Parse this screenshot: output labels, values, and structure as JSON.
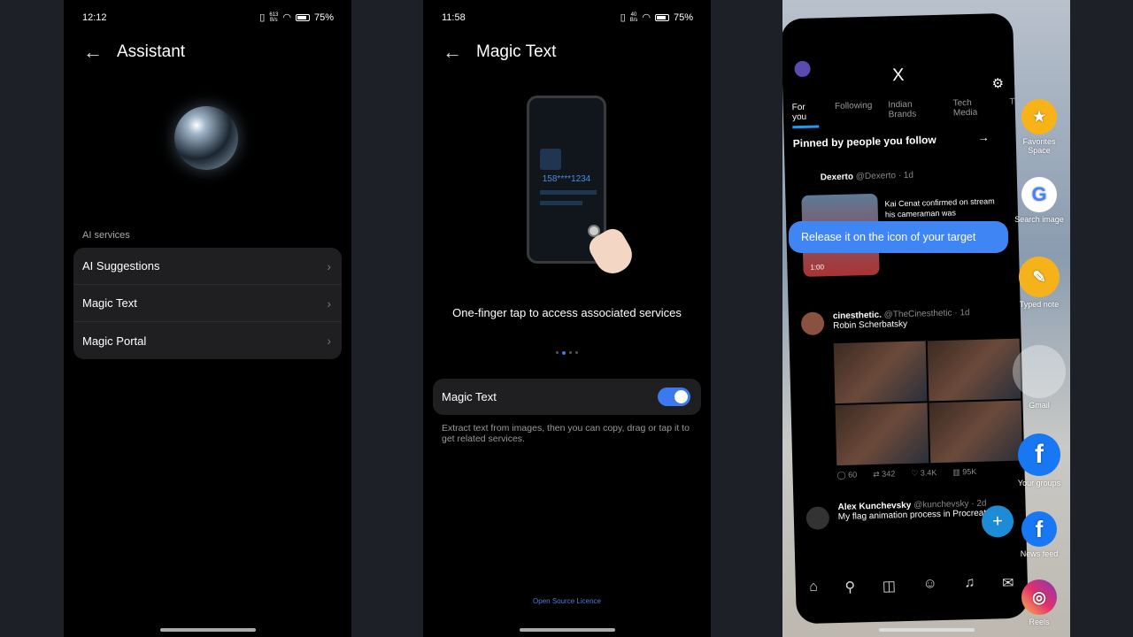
{
  "panel1": {
    "status": {
      "time": "12:12",
      "net_speed": "613",
      "net_unit": "B/s",
      "battery": "75%"
    },
    "title": "Assistant",
    "section": "AI services",
    "items": [
      {
        "label": "AI Suggestions"
      },
      {
        "label": "Magic Text"
      },
      {
        "label": "Magic Portal"
      }
    ]
  },
  "panel2": {
    "status": {
      "time": "11:58",
      "net_speed": "40",
      "net_unit": "B/s",
      "battery": "75%"
    },
    "title": "Magic Text",
    "illustration_number": "158****1234",
    "caption": "One-finger tap to access associated services",
    "page_dots": {
      "count": 4,
      "active": 2
    },
    "toggle": {
      "label": "Magic Text",
      "on": true,
      "color": "#3c79f0"
    },
    "description": "Extract text from images, then you can copy, drag or tap it to get related services.",
    "licence": "Open Source Licence"
  },
  "panel3": {
    "logo": "X",
    "tabs": [
      "For you",
      "Following",
      "Indian Brands",
      "Tech Media",
      "T"
    ],
    "pinned": "Pinned by people you follow",
    "tweets": [
      {
        "name": "Dexerto",
        "handle": "@Dexerto · 1d",
        "text": "Kai Cenat confirmed on stream his cameraman was",
        "duration": "1:00"
      },
      {
        "name": "cinesthetic.",
        "handle": "@TheCinesthetic · 1d",
        "text": "Robin Scherbatsky",
        "stats": {
          "replies": "60",
          "reposts": "342",
          "likes": "3.4K",
          "views": "95K"
        }
      },
      {
        "name": "Alex Kunchevsky",
        "handle": "@kunchevsky · 2d",
        "text": "My flag animation process in Procreate 🚩"
      }
    ],
    "tooltip": "Release it on the icon of your target",
    "shortcuts": [
      {
        "label": "Favorites Space",
        "icon": "star-folder-icon"
      },
      {
        "label": "Search image",
        "icon": "google-icon"
      },
      {
        "label": "Typed note",
        "icon": "pencil-note-icon"
      },
      {
        "label": "Gmail",
        "icon": "gmail-icon"
      },
      {
        "label": "Your groups",
        "icon": "facebook-icon"
      },
      {
        "label": "News feed",
        "icon": "facebook-icon"
      },
      {
        "label": "Reels",
        "icon": "instagram-icon"
      }
    ],
    "accent": "#1d9bf0"
  }
}
